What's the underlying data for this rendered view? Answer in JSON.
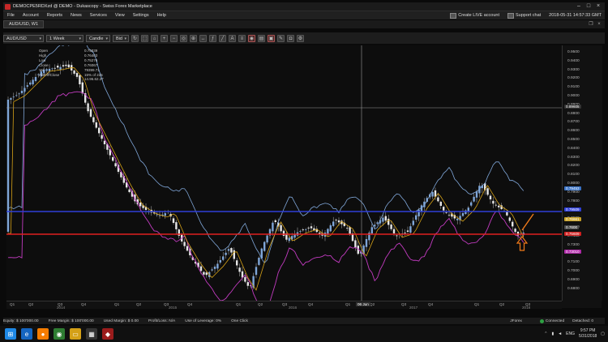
{
  "window": {
    "title": "DEMOCPE5RDXzd @ DEMO - Dukascopy - Swiss Forex Marketplace"
  },
  "menu": {
    "items": [
      "File",
      "Account",
      "Reports",
      "News",
      "Services",
      "View",
      "Settings",
      "Help"
    ],
    "create_live": "Create LIVE account",
    "support": "Support chat",
    "datetime": "2018-05-31 14:57:33 GMT"
  },
  "chart_tab": {
    "label": "AUD/USD, W1"
  },
  "toolbar": {
    "instrument": "AUD/USD",
    "period": "1 Week",
    "chart_type": "Candle",
    "side": "Bid"
  },
  "info": {
    "labels": [
      "Open",
      "High",
      "Low",
      "Close",
      "Vol"
    ],
    "values": [
      "0.75839",
      "0.76403",
      "0.75276",
      "0.76067",
      "79399.71"
    ],
    "extra": [
      "15% of 225",
      "14.96.62.27"
    ],
    "dir": "All/Off-Close"
  },
  "price_axis": {
    "ticks": [
      "0.9500",
      "0.9400",
      "0.9300",
      "0.9200",
      "0.9100",
      "0.9000",
      "0.8900",
      "0.8800",
      "0.8700",
      "0.8600",
      "0.8500",
      "0.8400",
      "0.8300",
      "0.8200",
      "0.8100",
      "0.8000",
      "0.7900",
      "0.7800",
      "0.7700",
      "0.7600",
      "0.7500",
      "0.7400",
      "0.7300",
      "0.7200",
      "0.7100",
      "0.7000",
      "0.6900",
      "0.6800"
    ],
    "labels": [
      {
        "text": "0.89605",
        "color": "#333333"
      },
      {
        "text": "0.79453",
        "color": "#3a72c4"
      },
      {
        "text": "0.79509",
        "color": "#2f3fd8"
      },
      {
        "text": "0.76661",
        "color": "#c9a227"
      },
      {
        "text": "0.7600",
        "color": "#4a4a4a"
      },
      {
        "text": "0.75609",
        "color": "#d12020"
      },
      {
        "text": "0.73010",
        "color": "#b02aa8"
      }
    ]
  },
  "time_axis": {
    "quarters": [
      "Q1",
      "Q2",
      "Q3",
      "Q4",
      "Q1",
      "Q2",
      "Q3",
      "Q4",
      "Q1",
      "Q2",
      "Q3",
      "Q4",
      "Q1",
      "Q2",
      "Q3",
      "Q4",
      "Q1",
      "Q2",
      "Q3"
    ],
    "years": [
      "2014",
      "2015",
      "2016",
      "2017",
      "2018"
    ],
    "cursor_date": "06 Jun"
  },
  "status": {
    "equity": "Equity: $ 100'000.00",
    "free_margin": "Free Margin: $ 100'000.00",
    "used_margin": "Used Margin: $ 0.00",
    "pl": "Profit/Loss: N/A",
    "leverage": "Use of Leverage: 0%",
    "oneclick": "One Click",
    "platform": "JForex",
    "connected": "Connected",
    "detached": "Detached: 0"
  },
  "taskbar": {
    "lang": "ENG",
    "time": "9:57 PM",
    "date": "5/31/2018"
  },
  "colors": {
    "bull": "#7fa6d8",
    "bear": "#e6e6e6",
    "upper_band": "#7fa6d8",
    "lower_band": "#c23bc0",
    "ma": "#d4a017",
    "blue_line": "#2f3fd8",
    "red_line": "#e02020",
    "arrow": "#f07a1a"
  }
}
